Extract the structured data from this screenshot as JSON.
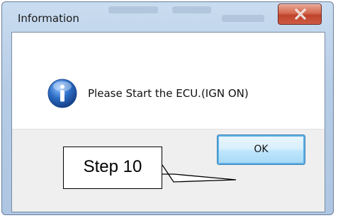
{
  "dialog": {
    "title": "Information",
    "message": "Please Start the ECU.(IGN ON)",
    "ok_label": "OK",
    "close_symbol": "X",
    "icon": "info-icon"
  },
  "annotation": {
    "label": "Step 10"
  },
  "colors": {
    "title_bar": "#b7cde6",
    "close_button": "#c0432b",
    "ok_button_border": "#3c7fb1",
    "info_icon": "#2b6cc4",
    "footer": "#efefef"
  }
}
